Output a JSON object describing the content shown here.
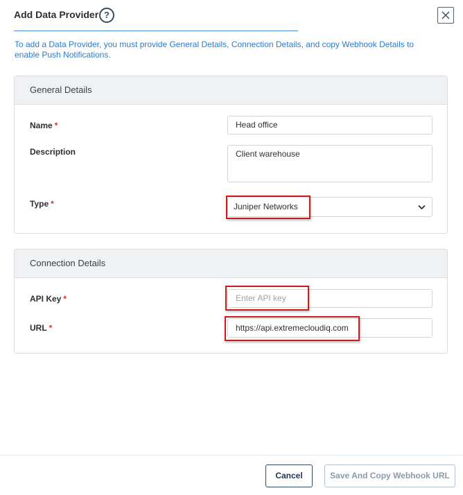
{
  "dialog": {
    "title": "Add Data Provider",
    "help_glyph": "?",
    "intro": "To add a Data Provider, you must provide General Details, Connection Details, and copy Webhook Details to enable Push Notifications."
  },
  "general": {
    "heading": "General Details",
    "name_label": "Name",
    "name_value": "Head office",
    "description_label": "Description",
    "description_value": "Client warehouse",
    "type_label": "Type",
    "type_value": "Juniper Networks"
  },
  "connection": {
    "heading": "Connection Details",
    "api_key_label": "API Key",
    "api_key_placeholder": "Enter API key",
    "url_label": "URL",
    "url_value": "https://api.extremecloudiq.com"
  },
  "required_mark": "*",
  "footer": {
    "cancel_label": "Cancel",
    "save_label": "Save And Copy Webhook URL"
  },
  "colors": {
    "accent": "#2a7bd0",
    "required": "#d0342c",
    "highlight": "#d0171a"
  }
}
